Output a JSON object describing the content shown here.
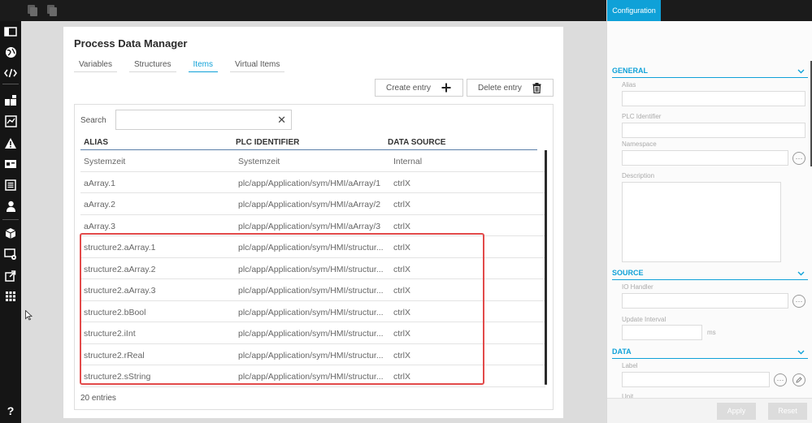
{
  "app": {
    "page_title": "Process Data Manager",
    "tabs": [
      {
        "label": "Variables"
      },
      {
        "label": "Structures"
      },
      {
        "label": "Items"
      },
      {
        "label": "Virtual Items"
      }
    ],
    "active_tab": "Items"
  },
  "toolbar": {
    "create_label": "Create entry",
    "delete_label": "Delete entry"
  },
  "search": {
    "label": "Search",
    "value": "",
    "placeholder": ""
  },
  "table": {
    "columns": [
      "ALIAS",
      "PLC IDENTIFIER",
      "DATA SOURCE"
    ],
    "rows": [
      {
        "alias": "Systemzeit",
        "plc": "Systemzeit",
        "source": "Internal"
      },
      {
        "alias": "aArray.1",
        "plc": "plc/app/Application/sym/HMI/aArray/1",
        "source": "ctrlX"
      },
      {
        "alias": "aArray.2",
        "plc": "plc/app/Application/sym/HMI/aArray/2",
        "source": "ctrlX"
      },
      {
        "alias": "aArray.3",
        "plc": "plc/app/Application/sym/HMI/aArray/3",
        "source": "ctrlX"
      },
      {
        "alias": "structure2.aArray.1",
        "plc": "plc/app/Application/sym/HMI/structur...",
        "source": "ctrlX"
      },
      {
        "alias": "structure2.aArray.2",
        "plc": "plc/app/Application/sym/HMI/structur...",
        "source": "ctrlX"
      },
      {
        "alias": "structure2.aArray.3",
        "plc": "plc/app/Application/sym/HMI/structur...",
        "source": "ctrlX"
      },
      {
        "alias": "structure2.bBool",
        "plc": "plc/app/Application/sym/HMI/structur...",
        "source": "ctrlX"
      },
      {
        "alias": "structure2.iInt",
        "plc": "plc/app/Application/sym/HMI/structur...",
        "source": "ctrlX"
      },
      {
        "alias": "structure2.rReal",
        "plc": "plc/app/Application/sym/HMI/structur...",
        "source": "ctrlX"
      },
      {
        "alias": "structure2.sString",
        "plc": "plc/app/Application/sym/HMI/structur...",
        "source": "ctrlX"
      }
    ],
    "entries_count": "20 entries"
  },
  "config": {
    "tab_label": "Configuration",
    "general": {
      "title": "GENERAL",
      "alias_label": "Alias",
      "plc_label": "PLC Identifier",
      "namespace_label": "Namespace",
      "description_label": "Description"
    },
    "source": {
      "title": "SOURCE",
      "io_label": "IO Handler",
      "interval_label": "Update Interval",
      "interval_unit": "ms"
    },
    "data": {
      "title": "DATA",
      "label_label": "Label",
      "unit_label": "Unit"
    },
    "apply_label": "Apply",
    "reset_label": "Reset"
  },
  "colors": {
    "accent": "#0fa1d8",
    "highlight": "#e24a4a",
    "sidebar": "#151515"
  },
  "icons": {
    "sidebar": [
      "home-icon",
      "dashboard-icon",
      "globe-icon",
      "code-icon",
      "structure-icon",
      "monitor-chart-icon",
      "warning-icon",
      "card-icon",
      "list-icon",
      "user-icon",
      "package-icon",
      "screen-settings-icon",
      "export-icon",
      "grid-icon",
      "help-icon"
    ]
  }
}
